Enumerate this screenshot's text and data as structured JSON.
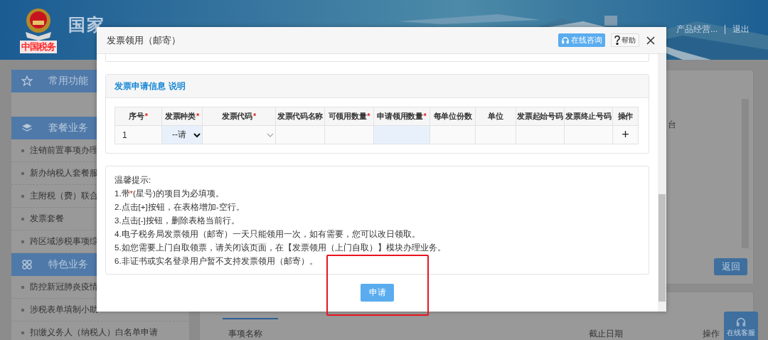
{
  "header": {
    "seal_text": "中国税务",
    "title": "国家",
    "user_text": "产品经营...",
    "logout": "退出"
  },
  "sidebar": {
    "sections": [
      {
        "title": "常用功能"
      },
      {
        "title": "套餐业务",
        "items": [
          "注销前置事项办理",
          "新办纳税人套餐服",
          "主附税（费）联合",
          "发票套餐",
          "跨区域涉税事项综"
        ]
      },
      {
        "title": "特色业务",
        "items": [
          "防控新冠肺炎疫情",
          "涉税表单填制小助",
          "扣缴义务人（纳税人）白名单申请"
        ]
      }
    ]
  },
  "main": {
    "side_text": "台",
    "back_button": "返回",
    "list_headers": [
      "事项名称",
      "截止日期",
      "操作"
    ]
  },
  "float_button": "在线客服",
  "dialog": {
    "title": "发票领用（邮寄）",
    "consult_button": "在线咨询",
    "help_button": "帮助",
    "section": {
      "title": "发票申请信息",
      "link": "说明"
    },
    "table": {
      "columns": [
        {
          "label": "序号",
          "required": true
        },
        {
          "label": "发票种类",
          "required": true
        },
        {
          "label": "发票代码",
          "required": true
        },
        {
          "label": "发票代码名称",
          "required": false
        },
        {
          "label": "可领用数量",
          "required": true
        },
        {
          "label": "申请领用数量",
          "required": true
        },
        {
          "label": "每单位份数",
          "required": false
        },
        {
          "label": "单位",
          "required": false
        },
        {
          "label": "发票起始号码",
          "required": false
        },
        {
          "label": "发票终止号码",
          "required": false
        },
        {
          "label": "操作",
          "required": false
        }
      ],
      "rows": [
        {
          "seq": "1",
          "invoice_type": "--请",
          "add_label": "+"
        }
      ]
    },
    "tips": {
      "title": "温馨提示:",
      "lines": [
        {
          "text": "1.带",
          "mark": "*",
          "after": "(星号)的项目为必填项。"
        },
        {
          "text": "2.点击[+]按钮，在表格增加-空行。"
        },
        {
          "text": "3.点击[-]按钮，删除表格当前行。"
        },
        {
          "text": "4.电子税务局发票领用（邮寄）一天只能领用一次，如有需要，您可以改日领取。"
        },
        {
          "text": "5.如您需要上门自取领票，请关闭该页面，在【发票领用（上门自取）】模块办理业务。"
        },
        {
          "text": "6.非证书或实名登录用户暂不支持发票领用（邮寄）。"
        }
      ]
    },
    "submit_button": "申请"
  }
}
